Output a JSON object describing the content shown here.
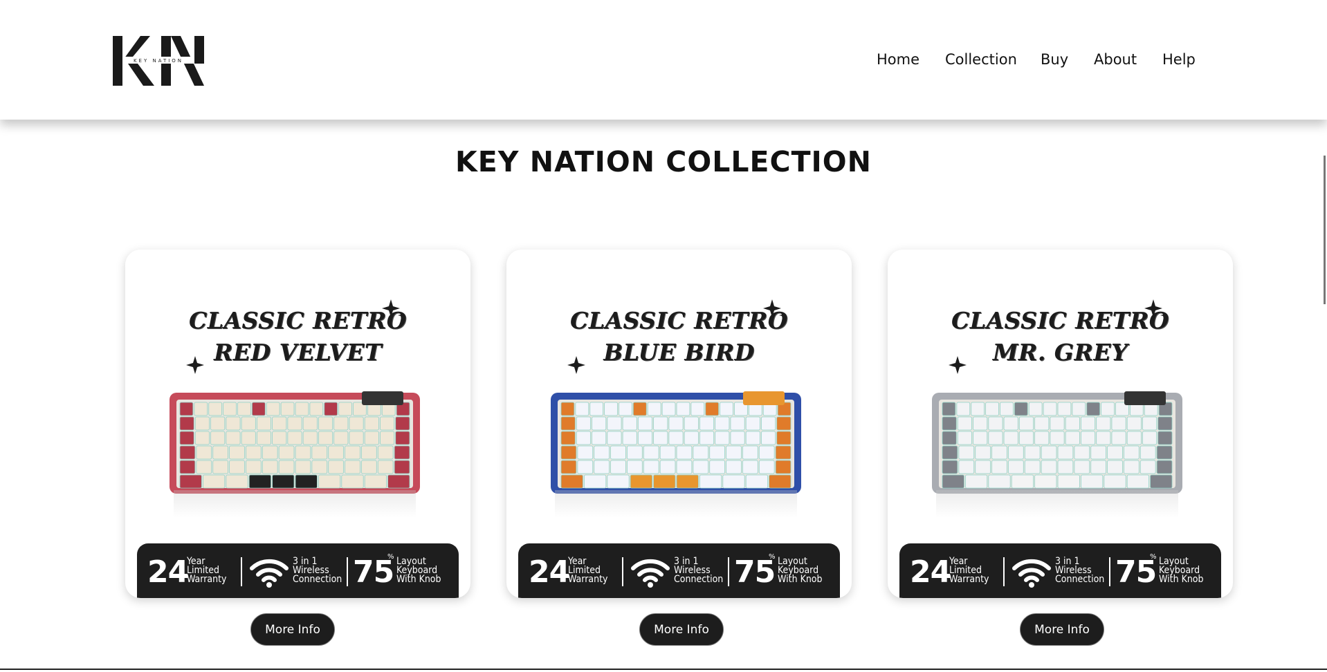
{
  "header": {
    "logo_text": "KEY NATION",
    "nav": [
      {
        "label": "Home"
      },
      {
        "label": "Collection"
      },
      {
        "label": "Buy"
      },
      {
        "label": "About"
      },
      {
        "label": "Help"
      }
    ]
  },
  "page_title": "KEY NATION COLLECTION",
  "cards": [
    {
      "line1": "CLASSIC RETRO",
      "line2": "RED VELVET",
      "button": "More Info",
      "colors": {
        "case": "#c64b5a",
        "accent": "#b23a4a",
        "keys": "#efe7d6",
        "space": "#222222"
      }
    },
    {
      "line1": "CLASSIC RETRO",
      "line2": "BLUE BIRD",
      "button": "More Info",
      "colors": {
        "case": "#2f4fa8",
        "accent": "#e07b2a",
        "keys": "#f3f5fb",
        "space": "#e8962f"
      }
    },
    {
      "line1": "CLASSIC RETRO",
      "line2": "MR. GREY",
      "button": "More Info",
      "colors": {
        "case": "#a9acb2",
        "accent": "#7f8289",
        "keys": "#f2f3f5",
        "space": "#f4f4f4"
      }
    }
  ],
  "features": {
    "warranty_num": "24",
    "warranty_l1": "Year",
    "warranty_l2": "Limited",
    "warranty_l3": "Warranty",
    "wireless_l1": "3 in 1",
    "wireless_l2": "Wireless",
    "wireless_l3": "Connection",
    "layout_num": "75",
    "layout_pct": "%",
    "layout_l1": "Layout",
    "layout_l2": "Keyboard",
    "layout_l3": "With Knob"
  }
}
